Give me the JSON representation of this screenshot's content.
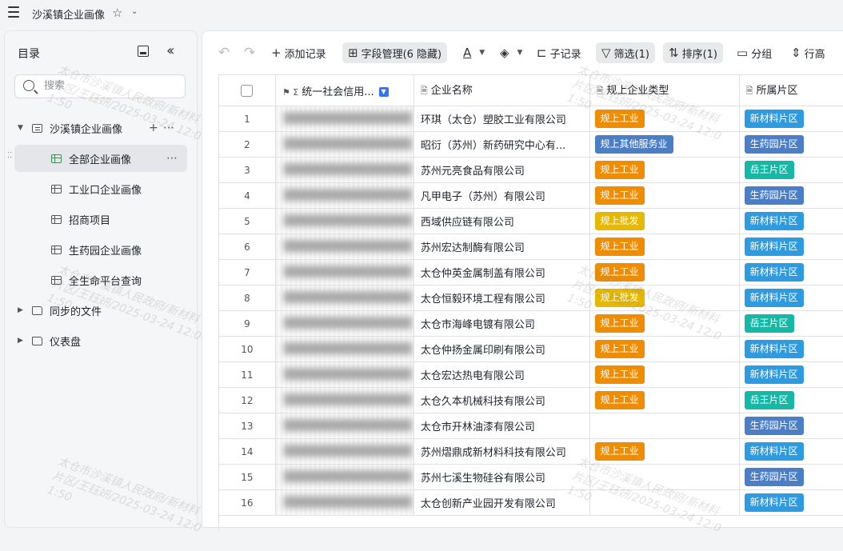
{
  "topbar": {
    "title": "沙溪镇企业画像"
  },
  "sidebar": {
    "heading": "目录",
    "search_placeholder": "搜索",
    "items": [
      {
        "label": "沙溪镇企业画像",
        "icon": "doc-icon",
        "level": 0,
        "expanded": true
      },
      {
        "label": "全部企业画像",
        "icon": "grid-icon",
        "level": 1,
        "active": true
      },
      {
        "label": "工业口企业画像",
        "icon": "grid-icon",
        "level": 1
      },
      {
        "label": "招商项目",
        "icon": "grid-icon",
        "level": 1
      },
      {
        "label": "生药园企业画像",
        "icon": "grid-icon",
        "level": 1
      },
      {
        "label": "全生命平台查询",
        "icon": "grid-icon",
        "level": 1
      },
      {
        "label": "同步的文件",
        "icon": "folder-icon",
        "level": 0
      },
      {
        "label": "仪表盘",
        "icon": "folder-icon",
        "level": 0
      }
    ]
  },
  "toolbar": {
    "add_record": "添加记录",
    "field_manage": "字段管理(6 隐藏)",
    "sub_record": "子记录",
    "filter": "筛选(1)",
    "sort": "排序(1)",
    "group": "分组",
    "row_height": "行高"
  },
  "table": {
    "columns": [
      "统一社会信用...",
      "企业名称",
      "规上企业类型",
      "所属片区"
    ],
    "rows": [
      {
        "no": "1",
        "name": "环琪（太仓）塑胶工业有限公司",
        "type": "规上工业",
        "area": "新材料片区"
      },
      {
        "no": "2",
        "name": "昭衍（苏州）新药研究中心有...",
        "type": "规上其他服务业",
        "area": "生药园片区"
      },
      {
        "no": "3",
        "name": "苏州元亮食品有限公司",
        "type": "规上工业",
        "area": "岳王片区"
      },
      {
        "no": "4",
        "name": "凡甲电子（苏州）有限公司",
        "type": "规上工业",
        "area": "生药园片区"
      },
      {
        "no": "5",
        "name": "西域供应链有限公司",
        "type": "规上批发",
        "area": "新材料片区"
      },
      {
        "no": "6",
        "name": "苏州宏达制酶有限公司",
        "type": "规上工业",
        "area": "新材料片区"
      },
      {
        "no": "7",
        "name": "太仓仲英金属制盖有限公司",
        "type": "规上工业",
        "area": "新材料片区"
      },
      {
        "no": "8",
        "name": "太仓恒毅环境工程有限公司",
        "type": "规上批发",
        "area": "新材料片区"
      },
      {
        "no": "9",
        "name": "太仓市海峰电镀有限公司",
        "type": "规上工业",
        "area": "岳王片区"
      },
      {
        "no": "10",
        "name": "太仓仲扬金属印刷有限公司",
        "type": "规上工业",
        "area": "新材料片区"
      },
      {
        "no": "11",
        "name": "太仓宏达热电有限公司",
        "type": "规上工业",
        "area": "新材料片区"
      },
      {
        "no": "12",
        "name": "太仓久本机械科技有限公司",
        "type": "规上工业",
        "area": "岳王片区"
      },
      {
        "no": "13",
        "name": "太仓市开林油漆有限公司",
        "type": "",
        "area": "生药园片区"
      },
      {
        "no": "14",
        "name": "苏州熠鼎成新材料科技有限公司",
        "type": "规上工业",
        "area": "新材料片区"
      },
      {
        "no": "15",
        "name": "苏州七溪生物硅谷有限公司",
        "type": "",
        "area": "生药园片区"
      },
      {
        "no": "16",
        "name": "太仓创新产业园开发有限公司",
        "type": "",
        "area": "新材料片区"
      }
    ]
  },
  "tag_colors": {
    "规上工业": "#f08c00",
    "规上其他服务业": "#4a7fc8",
    "规上批发": "#e6b800",
    "新材料片区": "#2d9be0",
    "生药园片区": "#4a7fc8",
    "岳王片区": "#14b8a6"
  },
  "watermark": [
    "太仓市沙溪镇人民政府/新材料",
    "片区/王钰妍/2025-03-24 12:0",
    "1:50"
  ]
}
